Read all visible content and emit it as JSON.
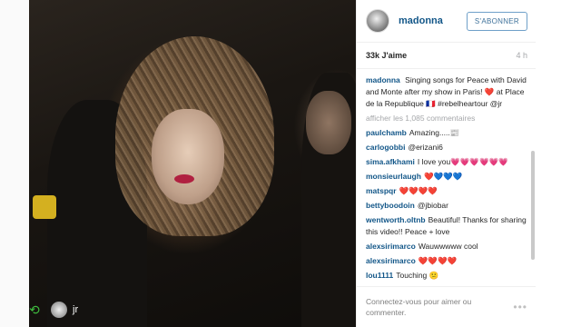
{
  "post": {
    "username": "madonna",
    "follow_label": "S'ABONNER",
    "likes": "33k J'aime",
    "time": "4 h",
    "caption_user": "madonna",
    "caption": "Singing songs for Peace with David and Monte after my show in Paris! ❤️ at Place de la Republique 🇫🇷 #rebelheartour @jr",
    "more_comments": "afficher les 1,085 commentaires",
    "regram_user": "jr"
  },
  "comments": [
    {
      "user": "paulchamb",
      "text": "Amazing.....📰"
    },
    {
      "user": "carlogobbi",
      "text": "@erizani6"
    },
    {
      "user": "sima.afkhami",
      "text": "I love you💗💗💗💗💗💗"
    },
    {
      "user": "monsieurlaugh",
      "text": "❤️💙💙💙"
    },
    {
      "user": "matspqr",
      "text": "❤️❤️❤️❤️"
    },
    {
      "user": "bettyboodoin",
      "text": "@jbiobar"
    },
    {
      "user": "wentworth.oltnb",
      "text": "Beautiful! Thanks for sharing this video!! Peace + love"
    },
    {
      "user": "alexsirimarco",
      "text": "Wauwwwww cool"
    },
    {
      "user": "alexsirimarco",
      "text": "❤️❤️❤️❤️"
    },
    {
      "user": "lou1111",
      "text": "Touching 😕"
    }
  ],
  "footer": {
    "login_text": "Connectez-vous pour aimer ou commenter.",
    "more_icon": "more-dots-icon"
  },
  "icons": {
    "regram": "regram-icon",
    "avatar": "avatar-icon"
  },
  "colors": {
    "link_blue": "#125688",
    "follow_border": "#6fa0c9",
    "regram_green": "#3fbf3f"
  }
}
